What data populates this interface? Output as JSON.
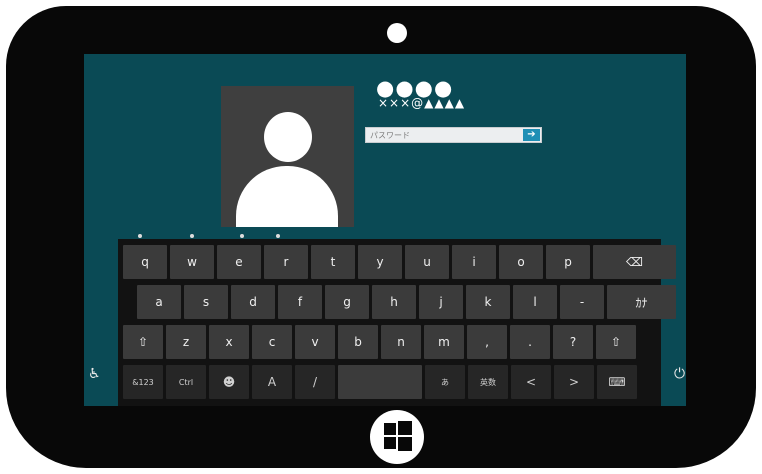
{
  "login": {
    "username": "●●●●",
    "email": "×××@▲▲▲▲",
    "password_placeholder": "パスワード",
    "submit_glyph": "➔"
  },
  "keyboard": {
    "row1": [
      "q",
      "w",
      "e",
      "r",
      "t",
      "y",
      "u",
      "i",
      "o",
      "p",
      "⌫"
    ],
    "row2": [
      "a",
      "s",
      "d",
      "f",
      "g",
      "h",
      "j",
      "k",
      "l",
      "-",
      "ｶﾅ"
    ],
    "row3": [
      "⇧",
      "z",
      "x",
      "c",
      "v",
      "b",
      "n",
      "m",
      ",",
      ".",
      "?",
      "⇧"
    ],
    "row4": [
      "&123",
      "Ctrl",
      "☻",
      "A",
      "/",
      "",
      "あ",
      "英数",
      "<",
      ">",
      "⌨"
    ]
  },
  "side": {
    "accessibility_glyph": "♿",
    "power_glyph": "⏻"
  }
}
